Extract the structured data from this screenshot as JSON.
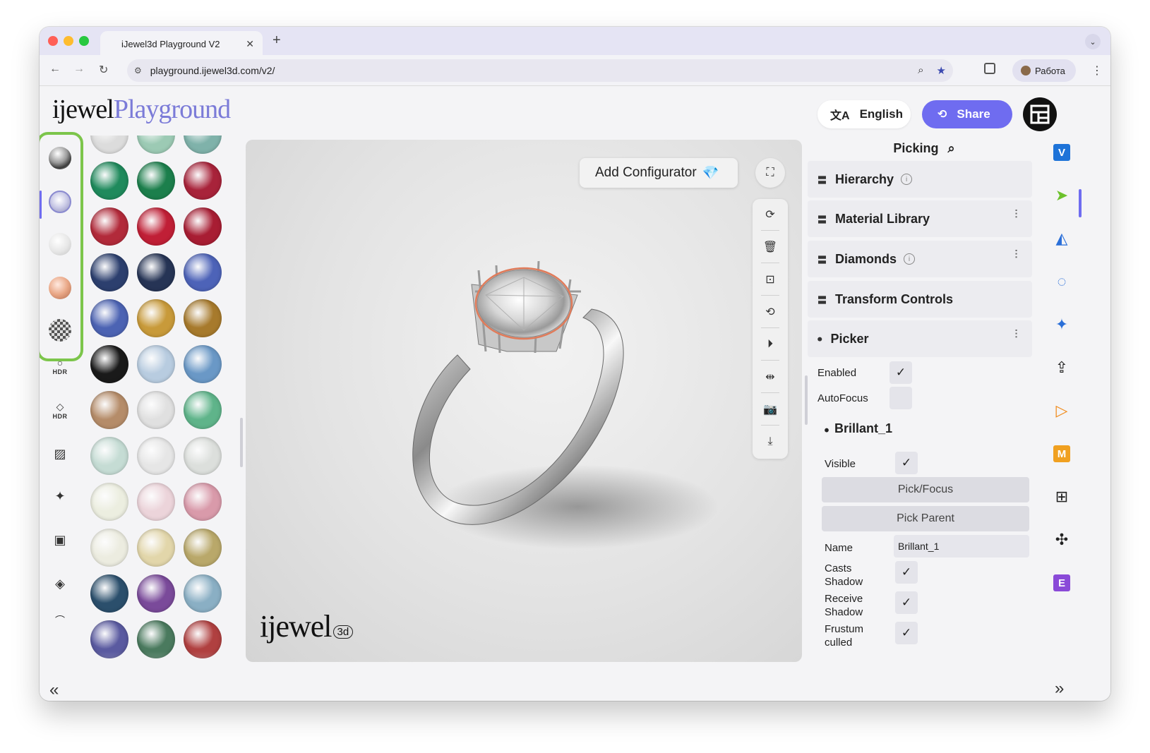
{
  "browser": {
    "tab_title": "iJewel3d Playground V2",
    "url": "playground.ijewel3d.com/v2/",
    "profile_label": "Работа"
  },
  "header": {
    "logo_word": "ijewel",
    "logo_accent": "Playground",
    "language_label": "English",
    "share_label": "Share"
  },
  "left_sidebar": {
    "materials": [
      "chrome-metal",
      "diamond",
      "pearl",
      "rose-gold",
      "checker-pattern"
    ],
    "tools": [
      {
        "icon": "hdr-environment-icon",
        "label": "HDR"
      },
      {
        "icon": "hdr-diamond-icon",
        "label": "HDR"
      },
      {
        "icon": "hatch-pattern-icon",
        "label": ""
      },
      {
        "icon": "sparkle-icon",
        "label": ""
      },
      {
        "icon": "image-background-icon",
        "label": ""
      },
      {
        "icon": "ground-plane-icon",
        "label": ""
      },
      {
        "icon": "person-icon",
        "label": ""
      }
    ]
  },
  "gem_palette": [
    "#dcdcdc",
    "#9ccab4",
    "#7fb2aa",
    "#1f8a5c",
    "#1c7f4c",
    "#a8233a",
    "#b22a3a",
    "#c01f36",
    "#a81d33",
    "#2c3f6e",
    "#263455",
    "#4d63b8",
    "#4c63b3",
    "#c89a3a",
    "#a77a2c",
    "#1a1a1a",
    "#b8cce0",
    "#6a98c6",
    "#b58c69",
    "#e0e0e0",
    "#5fb48a",
    "#c5dcd4",
    "#e6e6e6",
    "#dcdfdc",
    "#eceee0",
    "#ecd4da",
    "#d99aaa",
    "#ecece0",
    "#e2d6aa",
    "#b9a86a",
    "#2b4f6c",
    "#7a4a9a",
    "#8aafc4",
    "#5a5aa0",
    "#4a7a5e",
    "#b04040"
  ],
  "viewport": {
    "add_configurator_label": "Add Configurator",
    "watermark_word": "ijewel",
    "watermark_badge": "3d",
    "tools": [
      "rotate-icon",
      "delete-icon",
      "focus-icon",
      "rotate-reset-icon",
      "play-icon",
      "move-center-icon",
      "camera-icon",
      "download-icon"
    ]
  },
  "right_panel": {
    "title": "Picking",
    "sections": [
      "Hierarchy",
      "Material Library",
      "Diamonds",
      "Transform Controls",
      "Picker"
    ],
    "picker": {
      "enabled_label": "Enabled",
      "enabled": true,
      "autofocus_label": "AutoFocus",
      "autofocus": false,
      "object_title": "Brillant_1",
      "visible_label": "Visible",
      "visible": true,
      "pick_focus_label": "Pick/Focus",
      "pick_parent_label": "Pick Parent",
      "name_label": "Name",
      "name_value": "Brillant_1",
      "casts_shadow_label_1": "Casts",
      "casts_shadow_label_2": "Shadow",
      "casts_shadow": true,
      "receive_shadow_label_1": "Receive",
      "receive_shadow_label_2": "Shadow",
      "receive_shadow": true,
      "frustum_culled_label_1": "Frustum",
      "frustum_culled_label_2": "culled",
      "frustum_culled": true
    }
  },
  "far_right": {
    "icons": [
      {
        "name": "v-plugin-icon",
        "letter": "V",
        "color": "#1e73d8"
      },
      {
        "name": "cursor-pick-icon",
        "letter": "",
        "color": "#6cc12c"
      },
      {
        "name": "shapes-icon",
        "letter": "",
        "color": "#2a6fd8"
      },
      {
        "name": "loader-ring-icon",
        "letter": "",
        "color": "#2a6fd8"
      },
      {
        "name": "sparkle-star-icon",
        "letter": "",
        "color": "#2a6fd8"
      },
      {
        "name": "export-icon",
        "letter": "",
        "color": "#222222"
      },
      {
        "name": "play-triangle-icon",
        "letter": "",
        "color": "#f08a1a"
      },
      {
        "name": "m-plugin-icon",
        "letter": "M",
        "color": "#f0a020"
      },
      {
        "name": "grid-icon",
        "letter": "",
        "color": "#222222"
      },
      {
        "name": "puzzle-icon",
        "letter": "",
        "color": "#222222"
      },
      {
        "name": "e-plugin-icon",
        "letter": "E",
        "color": "#8a4ad8"
      }
    ]
  }
}
